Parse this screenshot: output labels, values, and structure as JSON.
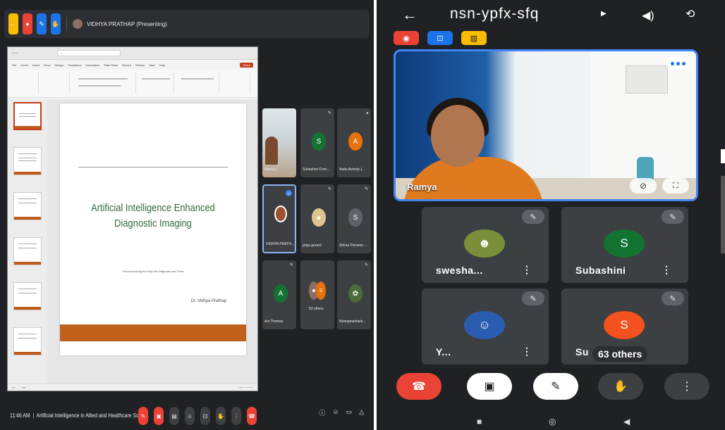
{
  "left": {
    "topbar": {
      "title": "VIDHYA PRATHAP (Presenting)",
      "buttons": [
        {
          "icon": "hand-icon",
          "color": "#fbbc04"
        },
        {
          "icon": "record-icon",
          "color": "#ea4335"
        },
        {
          "icon": "captions-icon",
          "color": "#1a73e8"
        },
        {
          "icon": "hand-off-icon",
          "color": "#1a73e8"
        }
      ]
    },
    "slide": {
      "title_line1": "Artificial Intelligence Enhanced",
      "title_line2": "Diagnostic Imaging",
      "subtitle": "Revolutionizing the Way We Diagnose and Treat",
      "author": "Dr. Vidhya Prathap"
    },
    "ppt": {
      "menu": [
        "File",
        "Home",
        "Insert",
        "Draw",
        "Design",
        "Transitions",
        "Animations",
        "Slide Show",
        "Record",
        "Review",
        "View",
        "Help"
      ],
      "share": "Share"
    },
    "tiles": [
      {
        "name": "Ramya (",
        "type": "photo"
      },
      {
        "name": "Subashini Com...",
        "initial": "S",
        "color": "#137333"
      },
      {
        "name": "Aadu Avinuty (...",
        "initial": "A",
        "color": "#e8710a"
      },
      {
        "name": "VIDHYA PRATH...",
        "type": "photo-active"
      },
      {
        "name": "priya gerard",
        "type": "photo-small"
      },
      {
        "name": "Shiraz Parveen ...",
        "initial": "S",
        "color": "#5f6368"
      },
      {
        "name": "Asi Thomas",
        "initial": "A",
        "color": "#137333"
      },
      {
        "name": "53 others",
        "type": "others"
      },
      {
        "name": "Niranjanashale...",
        "type": "photo-round"
      }
    ],
    "bottombar": {
      "time": "11:46 AM",
      "meeting": "Artificial Intelligence in Allied and Healthcare Scien..."
    }
  },
  "right": {
    "meeting_code": "nsn-ypfx-sfq",
    "main_speaker": "Ramya",
    "pills": [
      {
        "icon": "record-icon",
        "color": "#ea4335"
      },
      {
        "icon": "present-icon",
        "color": "#1a73e8"
      },
      {
        "icon": "no-video-icon",
        "color": "#fbbc04"
      }
    ],
    "grid": [
      {
        "name": "swesha...",
        "type": "photo",
        "color": "#7b8f3a"
      },
      {
        "name": "Subashini",
        "initial": "S",
        "color": "#137333"
      },
      {
        "name": "Y...",
        "type": "photo",
        "color": "#2a5db0"
      },
      {
        "name": "Su",
        "initial": "S",
        "color": "#f4511e",
        "others": "63 others"
      }
    ]
  }
}
